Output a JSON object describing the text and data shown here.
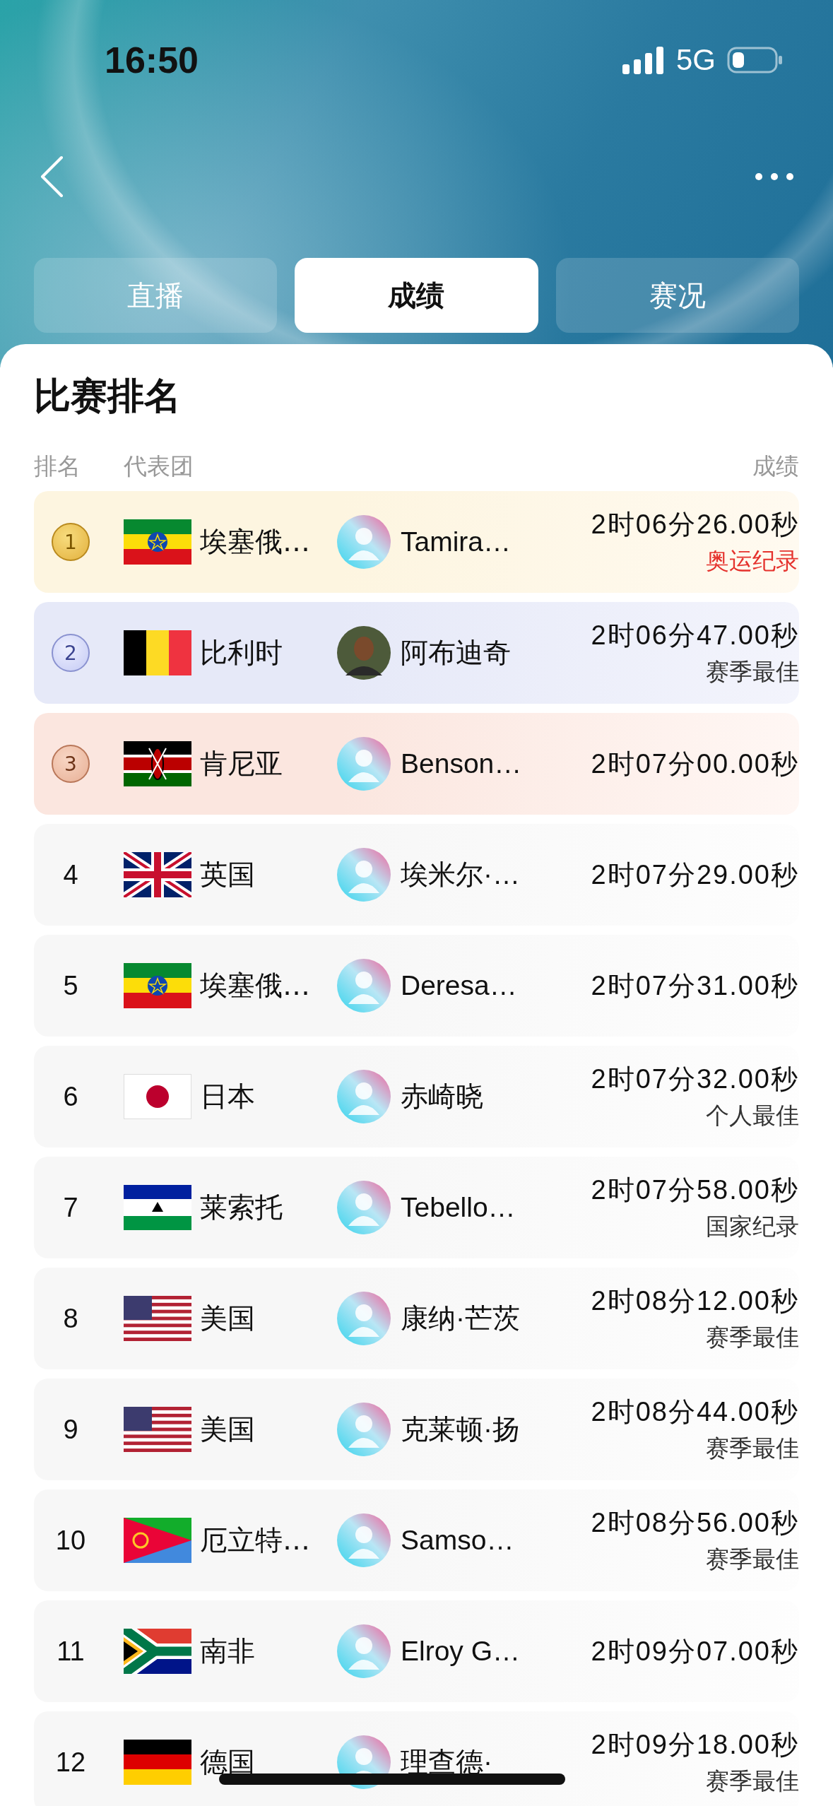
{
  "status_bar": {
    "time": "16:50",
    "network": "5G"
  },
  "tabs": [
    {
      "label": "直播",
      "selected": false
    },
    {
      "label": "成绩",
      "selected": true
    },
    {
      "label": "赛况",
      "selected": false
    }
  ],
  "section_title": "比赛排名",
  "columns": [
    "排名",
    "代表团",
    "成绩"
  ],
  "rows": [
    {
      "kind": "gold",
      "rank": "1",
      "flag": {
        "kind": "eth"
      },
      "country": "埃塞俄…",
      "avatar": {
        "kind": "placeholder"
      },
      "name": "Tamira…",
      "time": "2时06分26.00秒",
      "note": "奥运纪录",
      "highlight": true
    },
    {
      "kind": "silver",
      "rank": "2",
      "flag": {
        "kind": "bel"
      },
      "country": "比利时",
      "avatar": {
        "kind": "photo"
      },
      "name": "阿布迪奇",
      "time": "2时06分47.00秒",
      "note": "赛季最佳",
      "highlight": false
    },
    {
      "kind": "bronze",
      "rank": "3",
      "flag": {
        "kind": "ken"
      },
      "country": "肯尼亚",
      "avatar": {
        "kind": "placeholder"
      },
      "name": "Benson…",
      "time": "2时07分00.00秒"
    },
    {
      "kind": "plain",
      "rank": "4",
      "flag": {
        "kind": "gbr"
      },
      "country": "英国",
      "avatar": {
        "kind": "placeholder"
      },
      "name": "埃米尔·…",
      "time": "2时07分29.00秒"
    },
    {
      "kind": "plain",
      "rank": "5",
      "flag": {
        "kind": "eth"
      },
      "country": "埃塞俄…",
      "avatar": {
        "kind": "placeholder"
      },
      "name": "Deresa…",
      "time": "2时07分31.00秒"
    },
    {
      "kind": "plain",
      "rank": "6",
      "flag": {
        "kind": "jpn"
      },
      "country": "日本",
      "avatar": {
        "kind": "placeholder"
      },
      "name": "赤崎晓",
      "time": "2时07分32.00秒",
      "note": "个人最佳",
      "highlight": false
    },
    {
      "kind": "plain",
      "rank": "7",
      "flag": {
        "kind": "lso"
      },
      "country": "莱索托",
      "avatar": {
        "kind": "placeholder"
      },
      "name": "Tebello…",
      "time": "2时07分58.00秒",
      "note": "国家纪录",
      "highlight": false
    },
    {
      "kind": "plain",
      "rank": "8",
      "flag": {
        "kind": "usa"
      },
      "country": "美国",
      "avatar": {
        "kind": "placeholder"
      },
      "name": "康纳·芒茨",
      "time": "2时08分12.00秒",
      "note": "赛季最佳",
      "highlight": false
    },
    {
      "kind": "plain",
      "rank": "9",
      "flag": {
        "kind": "usa"
      },
      "country": "美国",
      "avatar": {
        "kind": "placeholder"
      },
      "name": "克莱顿·扬",
      "time": "2时08分44.00秒",
      "note": "赛季最佳",
      "highlight": false
    },
    {
      "kind": "plain",
      "rank": "10",
      "flag": {
        "kind": "eri"
      },
      "country": "厄立特…",
      "avatar": {
        "kind": "placeholder"
      },
      "name": "Samso…",
      "time": "2时08分56.00秒",
      "note": "赛季最佳",
      "highlight": false
    },
    {
      "kind": "plain",
      "rank": "11",
      "flag": {
        "kind": "rsa"
      },
      "country": "南非",
      "avatar": {
        "kind": "placeholder"
      },
      "name": "Elroy G…",
      "time": "2时09分07.00秒"
    },
    {
      "kind": "plain",
      "rank": "12",
      "flag": {
        "kind": "ger"
      },
      "country": "德国",
      "avatar": {
        "kind": "placeholder"
      },
      "name": "理查德·",
      "time": "2时09分18.00秒",
      "note": "赛季最佳",
      "highlight": false
    }
  ]
}
